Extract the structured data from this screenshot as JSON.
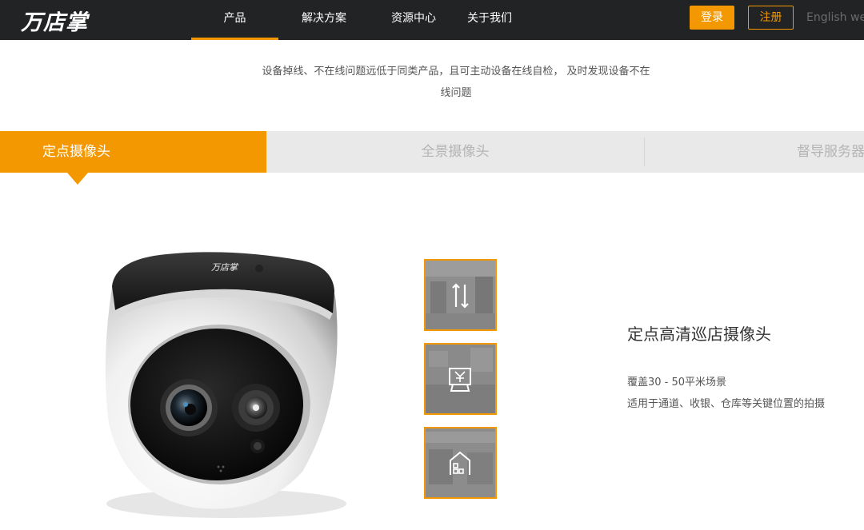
{
  "header": {
    "logo": "万店掌",
    "nav": [
      "产品",
      "解决方案",
      "资源中心",
      "关于我们"
    ],
    "login": "登录",
    "register": "注册",
    "english": "English web"
  },
  "intro": {
    "line1": "设备掉线、不在线问题远低于同类产品，且可主动设备在线自检， 及时发现设备不在",
    "line2": "线问题"
  },
  "tabs": [
    "定点摄像头",
    "全景摄像头",
    "督导服务器"
  ],
  "camera": {
    "brand": "万店掌"
  },
  "thumbnails": [
    "transfer-icon",
    "cashier-icon",
    "warehouse-icon"
  ],
  "product": {
    "title": "定点高清巡店摄像头",
    "desc1": "覆盖30 - 50平米场景",
    "desc2": "适用于通道、收银、仓库等关键位置的拍摄"
  },
  "colors": {
    "accent": "#f39800",
    "header_bg": "#222325",
    "tab_bg": "#e9e9e9"
  }
}
